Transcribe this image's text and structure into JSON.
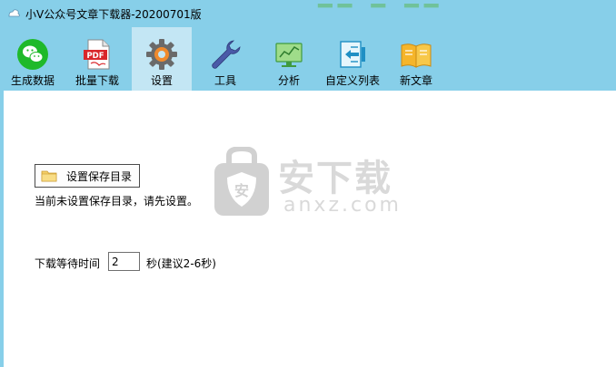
{
  "window": {
    "title": "小V公众号文章下载器-20200701版"
  },
  "toolbar": {
    "items": [
      {
        "label": "生成数据",
        "icon": "wechat-icon"
      },
      {
        "label": "批量下载",
        "icon": "pdf-icon"
      },
      {
        "label": "设置",
        "icon": "gear-icon",
        "active": true
      },
      {
        "label": "工具",
        "icon": "wrench-icon"
      },
      {
        "label": "分析",
        "icon": "monitor-chart-icon"
      },
      {
        "label": "自定义列表",
        "icon": "list-arrow-icon"
      },
      {
        "label": "新文章",
        "icon": "book-icon"
      }
    ]
  },
  "settings": {
    "save_dir_button": "设置保存目录",
    "save_dir_notice": "当前未设置保存目录，请先设置。",
    "wait_label": "下载等待时间",
    "wait_value": "2",
    "wait_hint": "秒(建议2-6秒)"
  },
  "watermark": {
    "text_cn": "安下载",
    "text_en": "anxz.com"
  },
  "colors": {
    "toolbar_bg": "#87cfe9",
    "active_tab_bg": "#c3e6f4",
    "content_bg": "#ffffff"
  }
}
